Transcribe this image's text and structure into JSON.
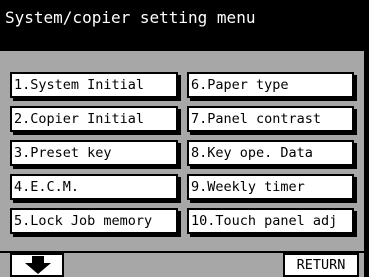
{
  "title": "System/copier setting menu",
  "menu": {
    "left": [
      "1.System Initial",
      "2.Copier Initial",
      "3.Preset key",
      "4.E.C.M.",
      "5.Lock Job memory"
    ],
    "right": [
      "6.Paper type",
      "7.Panel contrast",
      "8.Key ope. Data",
      "9.Weekly timer",
      "10.Touch panel adj"
    ]
  },
  "footer": {
    "scroll_icon": "down-arrow-icon",
    "return_label": "RETURN"
  }
}
